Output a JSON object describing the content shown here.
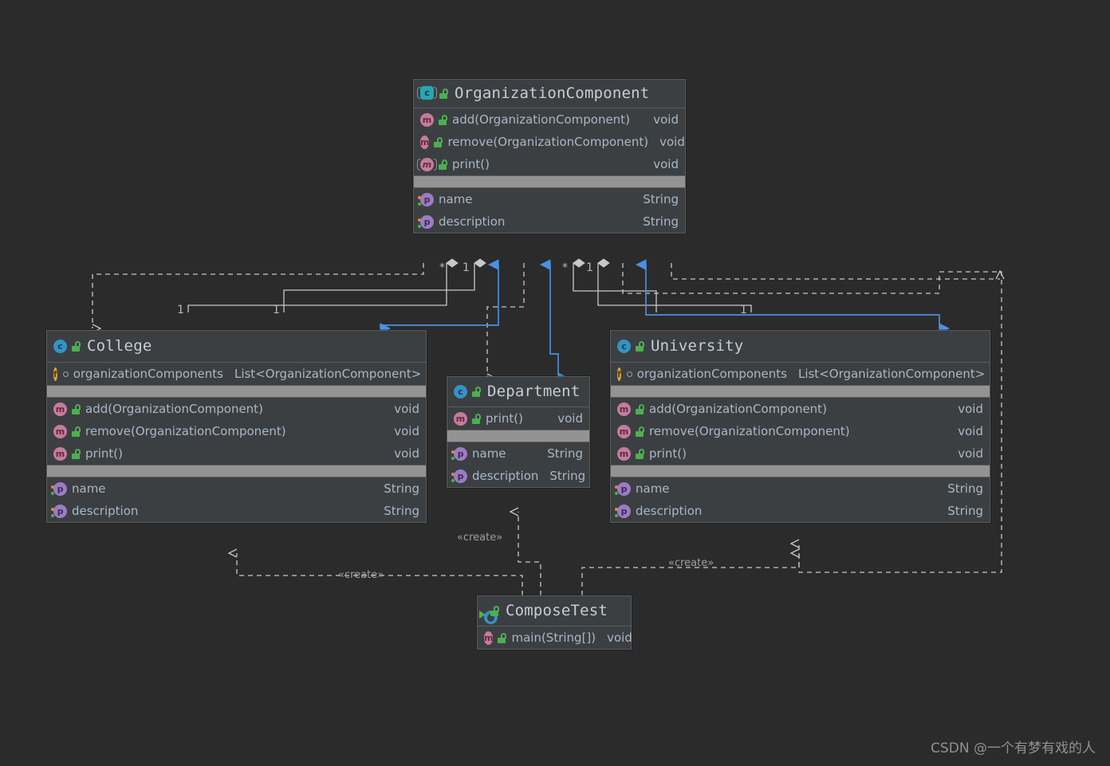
{
  "diagram": {
    "type": "uml-class-diagram",
    "background_color": "#2b2b2b",
    "box_fill": "#3c3f41",
    "inheritance_arrow_color": "#4a90e2",
    "association_line_color": "#c8c8c8",
    "watermark": "CSDN @一个有梦有戏的人"
  },
  "classes": {
    "organization_component": {
      "name": "OrganizationComponent",
      "icon": "abstract-class-icon",
      "visibility_icon": "unlocked-public-icon",
      "methods": [
        {
          "icon": "method-icon",
          "name": "add(OrganizationComponent)",
          "type": "void"
        },
        {
          "icon": "method-icon",
          "name": "remove(OrganizationComponent)",
          "type": "void"
        },
        {
          "icon": "abstract-method-icon",
          "name": "print()",
          "type": "void"
        }
      ],
      "properties": [
        {
          "icon": "property-icon",
          "name": "name",
          "type": "String"
        },
        {
          "icon": "property-icon",
          "name": "description",
          "type": "String"
        }
      ]
    },
    "college": {
      "name": "College",
      "icon": "class-icon",
      "visibility_icon": "unlocked-public-icon",
      "fields": [
        {
          "icon": "field-icon",
          "name": "organizationComponents",
          "type": "List<OrganizationComponent>"
        }
      ],
      "methods": [
        {
          "icon": "method-icon",
          "name": "add(OrganizationComponent)",
          "type": "void"
        },
        {
          "icon": "method-icon",
          "name": "remove(OrganizationComponent)",
          "type": "void"
        },
        {
          "icon": "method-icon",
          "name": "print()",
          "type": "void"
        }
      ],
      "properties": [
        {
          "icon": "property-icon",
          "name": "name",
          "type": "String"
        },
        {
          "icon": "property-icon",
          "name": "description",
          "type": "String"
        }
      ]
    },
    "department": {
      "name": "Department",
      "icon": "class-icon",
      "visibility_icon": "unlocked-public-icon",
      "methods": [
        {
          "icon": "method-icon",
          "name": "print()",
          "type": "void"
        }
      ],
      "properties": [
        {
          "icon": "property-icon",
          "name": "name",
          "type": "String"
        },
        {
          "icon": "property-icon",
          "name": "description",
          "type": "String"
        }
      ]
    },
    "university": {
      "name": "University",
      "icon": "class-icon",
      "visibility_icon": "unlocked-public-icon",
      "fields": [
        {
          "icon": "field-icon",
          "name": "organizationComponents",
          "type": "List<OrganizationComponent>"
        }
      ],
      "methods": [
        {
          "icon": "method-icon",
          "name": "add(OrganizationComponent)",
          "type": "void"
        },
        {
          "icon": "method-icon",
          "name": "remove(OrganizationComponent)",
          "type": "void"
        },
        {
          "icon": "method-icon",
          "name": "print()",
          "type": "void"
        }
      ],
      "properties": [
        {
          "icon": "property-icon",
          "name": "name",
          "type": "String"
        },
        {
          "icon": "property-icon",
          "name": "description",
          "type": "String"
        }
      ]
    },
    "compose_test": {
      "name": "ComposeTest",
      "icon": "runnable-class-icon",
      "visibility_icon": "unlocked-public-icon",
      "methods": [
        {
          "icon": "method-icon",
          "name": "main(String[])",
          "type": "void"
        }
      ]
    }
  },
  "edge_labels": {
    "create_left": "«create»",
    "create_middle": "«create»",
    "create_right": "«create»",
    "mult_star_1": "*",
    "mult_one_1": "1",
    "mult_star_2": "*",
    "mult_one_2": "1",
    "mult_college_a": "1",
    "mult_college_b": "1",
    "mult_university_a": "1",
    "mult_university_b": "1"
  }
}
